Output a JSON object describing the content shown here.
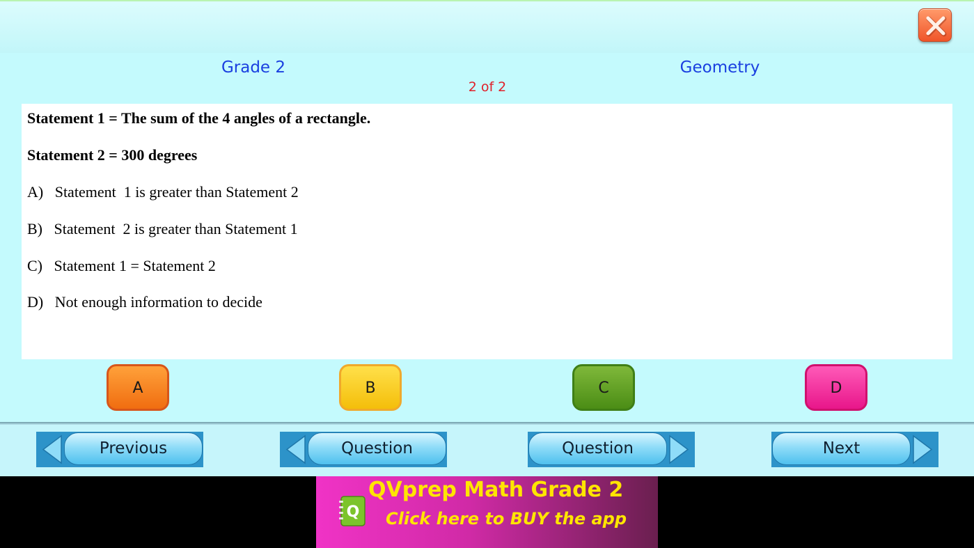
{
  "header": {
    "grade": "Grade 2",
    "subject": "Geometry",
    "progress": "2 of 2"
  },
  "question": {
    "statement1": "Statement 1 = The sum of the 4 angles of a rectangle.",
    "statement2": "Statement 2 = 300 degrees",
    "options": [
      "A)   Statement  1 is greater than Statement 2",
      "B)   Statement  2 is greater than Statement 1",
      "C)   Statement 1 = Statement 2",
      "D)   Not enough information to decide"
    ]
  },
  "answers": {
    "a": "A",
    "b": "B",
    "c": "C",
    "d": "D"
  },
  "nav": {
    "previous": "Previous",
    "question_back": "Question",
    "question_forward": "Question",
    "next": "Next"
  },
  "ad": {
    "title": "QVprep Math Grade 2",
    "subtitle": "Click here to BUY the app",
    "logo_letter": "Q"
  },
  "colors": {
    "accent_blue": "#1a3fe0",
    "progress_red": "#e0202a",
    "ad_yellow": "#ffe500"
  }
}
